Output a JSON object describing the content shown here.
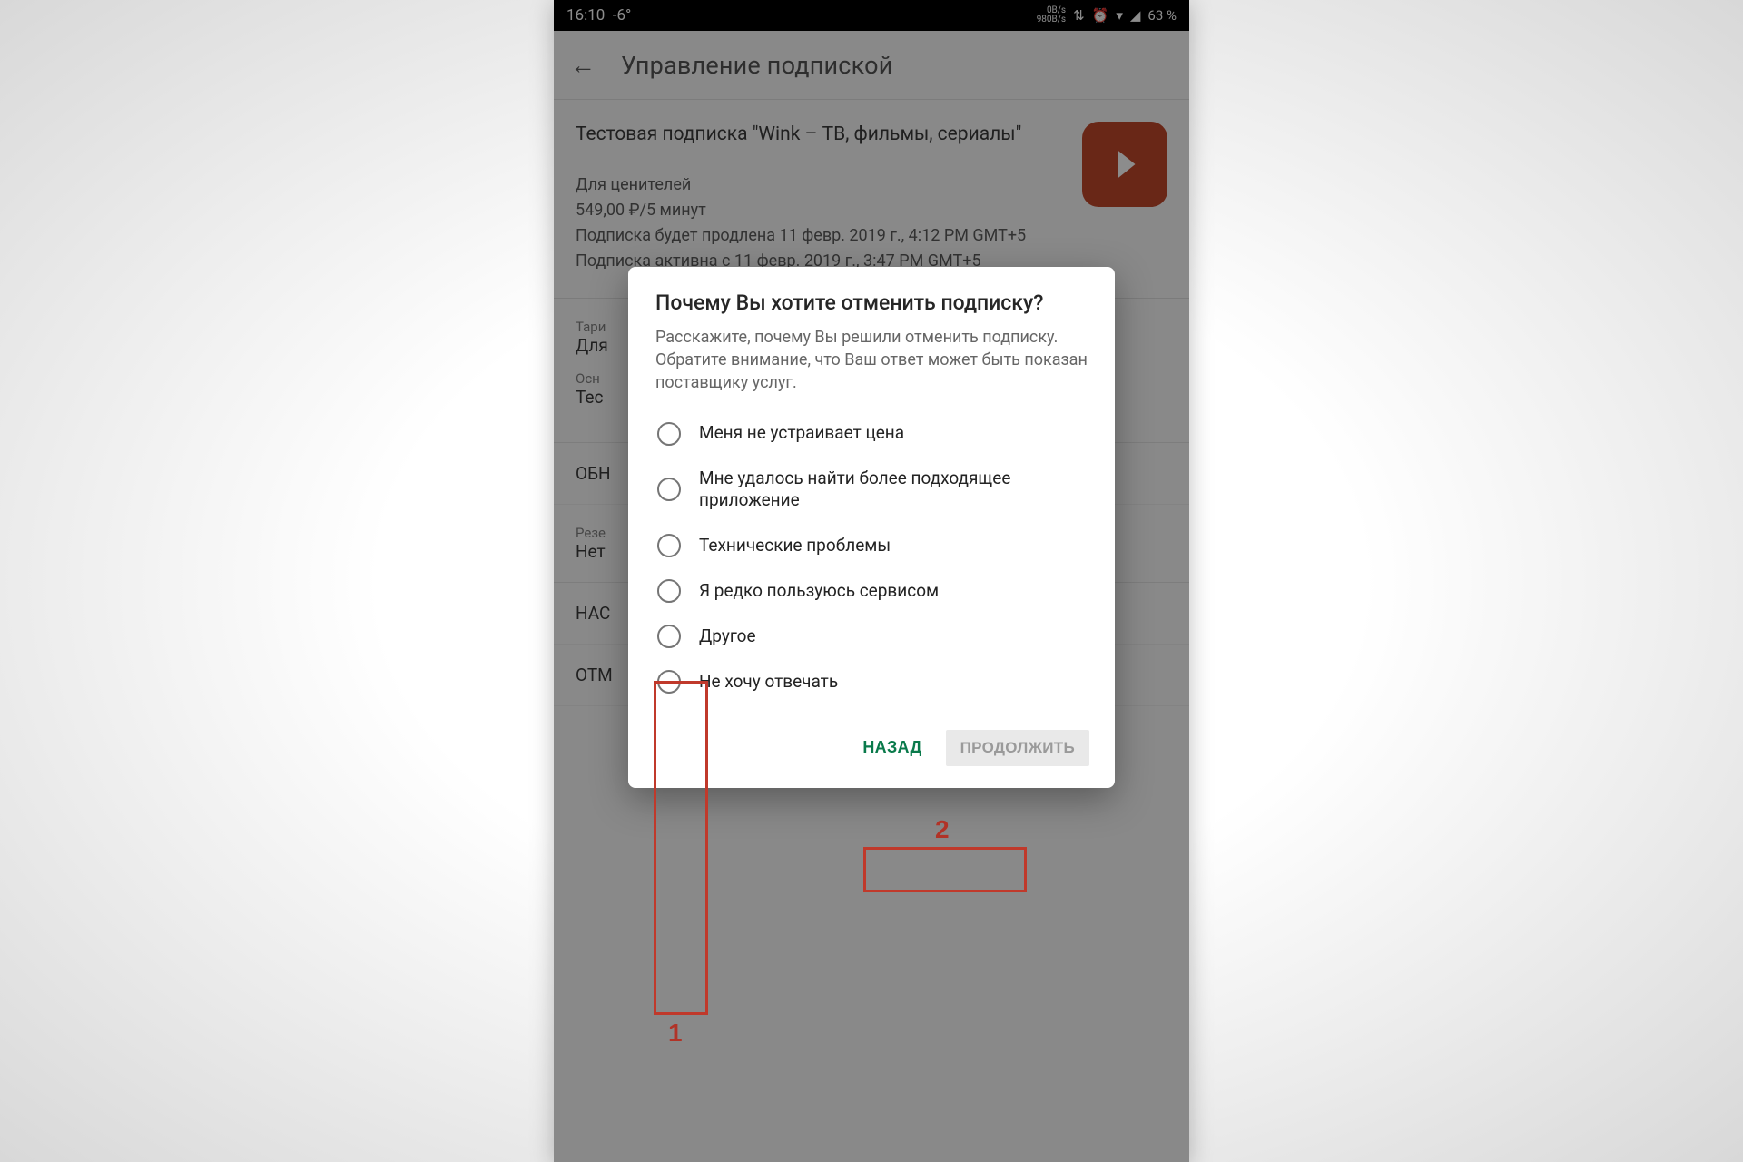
{
  "status": {
    "time": "16:10",
    "temp": "-6°",
    "speed_top": "0B/s",
    "speed_bottom": "980B/s",
    "battery": "63 %"
  },
  "header": {
    "title": "Управление подпиской"
  },
  "subscription": {
    "title": "Тестовая подписка \"Wink – ТВ, фильмы, сериалы\"",
    "plan_line": "Для ценителей",
    "price_line": "549,00 ₽/5 минут",
    "renew_line": "Подписка будет продлена 11 февр. 2019 г., 4:12 PM GMT+5",
    "active_line": "Подписка активна с 11 февр. 2019 г., 3:47 PM GMT+5"
  },
  "plan": {
    "tariff_label": "Тари",
    "tariff_value": "Для",
    "primary_label": "Осн",
    "primary_value": "Тес",
    "refresh": "ОБН",
    "backup_label": "Резе",
    "backup_value": "Нет",
    "settings": "НАС",
    "cancel": "ОТМ"
  },
  "dialog": {
    "title": "Почему Вы хотите отменить подписку?",
    "desc": "Расскажите, почему Вы решили отменить подписку. Обратите внимание, что Ваш ответ может быть показан поставщику услуг.",
    "options": [
      "Меня не устраивает цена",
      "Мне удалось найти более подходящее приложение",
      "Технические проблемы",
      "Я редко пользуюсь сервисом",
      "Другое",
      "Не хочу отвечать"
    ],
    "back": "НАЗАД",
    "continue": "ПРОДОЛЖИТЬ"
  },
  "annotations": {
    "num1": "1",
    "num2": "2"
  }
}
